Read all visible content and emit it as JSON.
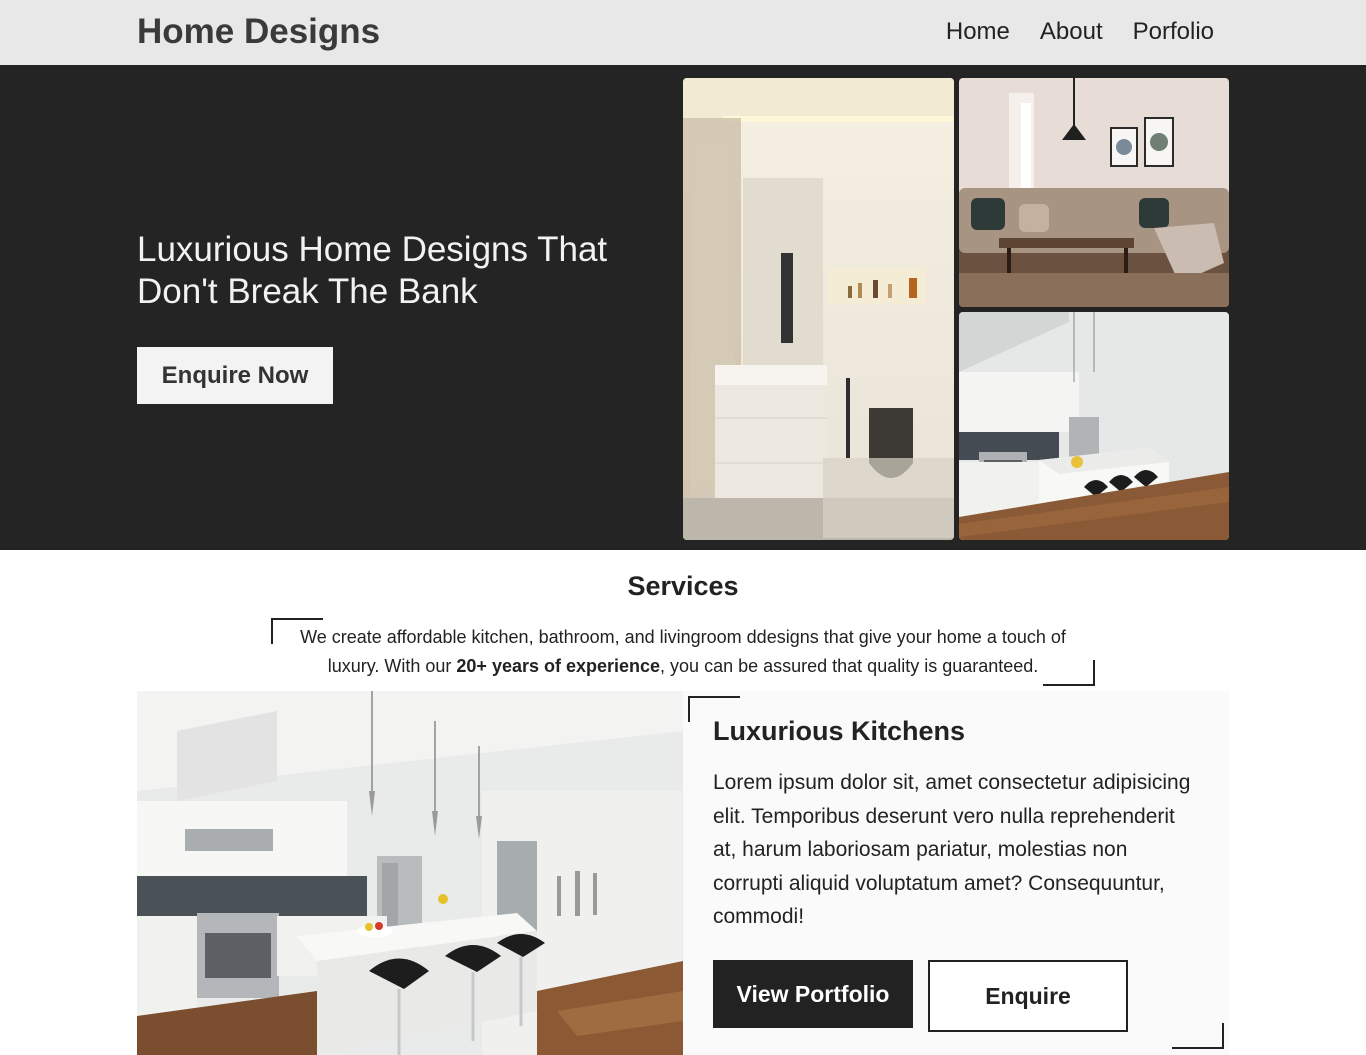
{
  "header": {
    "brand": "Home Designs",
    "nav": [
      "Home",
      "About",
      "Porfolio"
    ]
  },
  "hero": {
    "title": "Luxurious Home Designs That Don't Break The Bank",
    "cta": "Enquire Now",
    "images": [
      "bathroom-photo",
      "living-room-photo",
      "kitchen-photo"
    ]
  },
  "services": {
    "title": "Services",
    "text_before": "We create affordable kitchen, bathroom, and livingroom ddesigns that give your home a touch of luxury. With our ",
    "text_bold": "20+ years of experience",
    "text_after": ", you can be assured that quality is guaranteed."
  },
  "kitchens": {
    "title": "Luxurious Kitchens",
    "body": "Lorem ipsum dolor sit, amet consectetur adipisicing elit. Temporibus deserunt vero nulla reprehenderit at, harum laboriosam pariatur, molestias non corrupti aliquid voluptatum amet? Consequuntur, commodi!",
    "primary_button": "View Portfolio",
    "secondary_button": "Enquire"
  },
  "colors": {
    "header_bg": "#e8e8e8",
    "hero_bg": "#242424",
    "dark_button": "#222222"
  }
}
